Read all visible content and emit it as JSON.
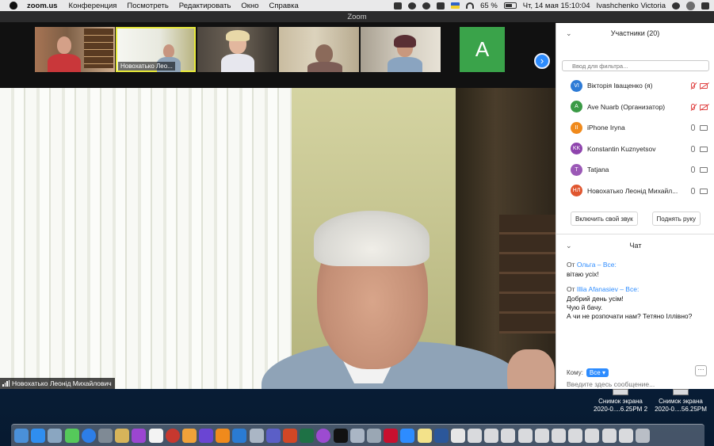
{
  "menubar": {
    "app_name": "zoom.us",
    "menu_items": [
      "Конференция",
      "Посмотреть",
      "Редактировать",
      "Окно",
      "Справка"
    ],
    "battery": "65 %",
    "clock": "Чт, 14 мая   15:10:04",
    "user": "Ivashchenko Victoria"
  },
  "window": {
    "title": "Zoom"
  },
  "gallery": {
    "thumbs": [
      {
        "label": ""
      },
      {
        "label": "Новохатько Лео..."
      },
      {
        "label": ""
      },
      {
        "label": ""
      },
      {
        "label": ""
      },
      {
        "letter": "A"
      }
    ],
    "next_icon": "chevron-right-icon"
  },
  "main_video": {
    "speaker": "Новохатько Леонід Михайлович"
  },
  "participants": {
    "title": "Участники (20)",
    "filter_placeholder": "Ввод для фильтра...",
    "list": [
      {
        "initials": "VI",
        "name": "Вікторія Іващенко (я)",
        "color": "#2e7bd6",
        "mic": "off",
        "cam": "off"
      },
      {
        "initials": "A",
        "name": "Ave Nuarb (Организатор)",
        "color": "#3a9a45",
        "mic": "off",
        "cam": "off"
      },
      {
        "initials": "II",
        "name": "iPhone Iryna",
        "color": "#f08a1c",
        "mic": "on",
        "cam": "on"
      },
      {
        "initials": "KK",
        "name": "Konstantin Kuznyetsov",
        "color": "#8e44ad",
        "mic": "on",
        "cam": "on"
      },
      {
        "initials": "T",
        "name": "Tatjana",
        "color": "#9b59b6",
        "mic": "on",
        "cam": "on"
      },
      {
        "initials": "НЛ",
        "name": "Новохатько Леонід Михайл...",
        "color": "#e0562f",
        "mic": "on",
        "cam": "on"
      }
    ],
    "unmute_label": "Включить свой звук",
    "raise_hand_label": "Поднять руку"
  },
  "chat": {
    "title": "Чат",
    "messages": [
      {
        "from_prefix": "От ",
        "from": "Ольга – Все:",
        "lines": [
          "вітаю усіх!"
        ]
      },
      {
        "from_prefix": "От ",
        "from": "Illia Afanasiev – Все:",
        "lines": [
          "Добрий день усім!",
          "Чую й бачу.",
          "А чи не розпочати нам? Тетяно Іллівно?"
        ]
      }
    ],
    "to_label": "Кому:",
    "to_value": "Все",
    "input_placeholder": "Введите здесь сообщение..."
  },
  "desktop": {
    "files": [
      {
        "line1": "Снимок экрана",
        "line2": "2020-0....6.25PM 2"
      },
      {
        "line1": "Снимок экрана",
        "line2": "2020-0....56.25PM"
      }
    ]
  },
  "dock": {
    "icons": [
      "finder-icon",
      "appstore-icon",
      "preview-icon",
      "messages-icon",
      "safari-icon",
      "system-preferences-icon",
      "notes-icon",
      "siri-icon",
      "calendar-icon",
      "photo-booth-icon",
      "photos-icon",
      "imovie-icon",
      "books-icon",
      "xcode-icon",
      "help-icon",
      "teams-icon",
      "powerpoint-icon",
      "excel-icon",
      "podcasts-icon",
      "apple-tv-icon",
      "help-icon-2",
      "script-icon",
      "acrobat-icon",
      "zoom-icon",
      "notes-app-icon",
      "word-icon",
      "document-icon",
      "stack-icon-1",
      "stack-icon-2",
      "stack-icon-3",
      "stack-icon-4",
      "stack-icon-5",
      "stack-icon-6",
      "stack-icon-7",
      "stack-icon-8",
      "stack-icon-9",
      "stack-icon-10",
      "trash-icon"
    ],
    "colors": [
      "#4a90d9",
      "#2f8ef0",
      "#8aa6c1",
      "#55c95a",
      "#2d7ee8",
      "#7f8a95",
      "#d7b45a",
      "#9b46d1",
      "#f3f3f3",
      "#c7382f",
      "#f0a23a",
      "#6a45d3",
      "#f08a1c",
      "#2a7bd3",
      "#aab6c5",
      "#5b5fc7",
      "#d24726",
      "#1e7145",
      "#9c4bd1",
      "#111111",
      "#aab6c5",
      "#9aa7b4",
      "#c8102e",
      "#2d8cff",
      "#f3e28a",
      "#2b579a",
      "#e6e6e6",
      "#d9dadd",
      "#d9dadd",
      "#d9dadd",
      "#d9dadd",
      "#d9dadd",
      "#d9dadd",
      "#d9dadd",
      "#d9dadd",
      "#d9dadd",
      "#d9dadd",
      "#b9bec6"
    ]
  }
}
